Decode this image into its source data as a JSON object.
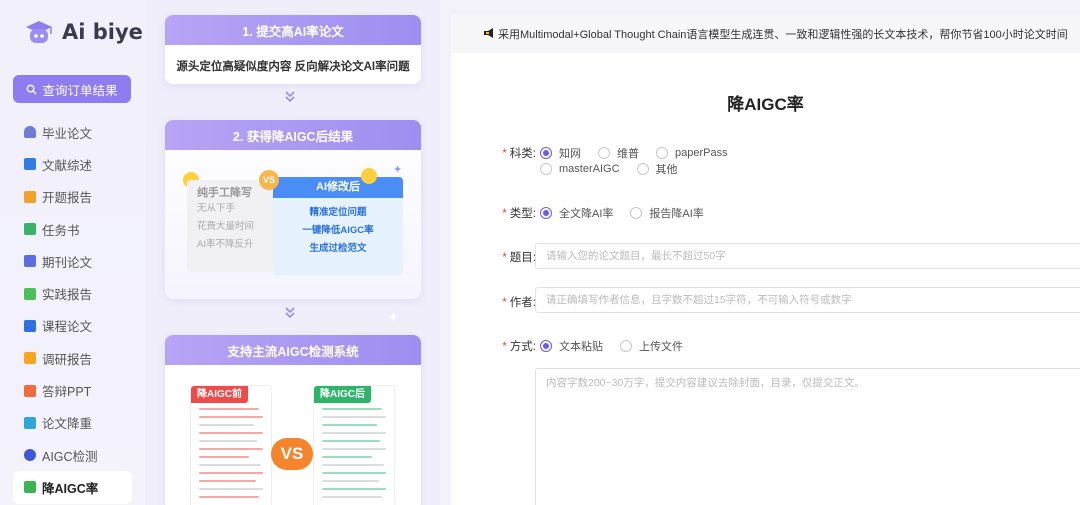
{
  "brand": {
    "name": "Ai biye"
  },
  "sidebar": {
    "order_button": "查询订单结果",
    "items": [
      {
        "label": "毕业论文",
        "icon": "graduation-cap-icon",
        "color": "#6d7bd9"
      },
      {
        "label": "文献综述",
        "icon": "book-icon",
        "color": "#2f7de1"
      },
      {
        "label": "开题报告",
        "icon": "report-icon",
        "color": "#f2a22b"
      },
      {
        "label": "任务书",
        "icon": "task-book-icon",
        "color": "#37b36a"
      },
      {
        "label": "期刊论文",
        "icon": "journal-icon",
        "color": "#5b6ee1"
      },
      {
        "label": "实践报告",
        "icon": "practice-report-icon",
        "color": "#4cbf5a"
      },
      {
        "label": "课程论文",
        "icon": "course-paper-icon",
        "color": "#2f6fe1"
      },
      {
        "label": "调研报告",
        "icon": "survey-icon",
        "color": "#f5a623"
      },
      {
        "label": "答辩PPT",
        "icon": "ppt-icon",
        "color": "#f06a3c"
      },
      {
        "label": "论文降重",
        "icon": "paper-reduce-icon",
        "color": "#2fa5d9"
      },
      {
        "label": "AIGC检测",
        "icon": "aigc-detect-icon",
        "color": "#3c5ad6"
      },
      {
        "label": "降AIGC率",
        "icon": "ai-reduce-icon",
        "color": "#3cb454",
        "active": true
      }
    ]
  },
  "promo": {
    "step1_title": "1. 提交高AI率论文",
    "step1_sub": "源头定位高疑似度内容 反向解决论文AI率问题",
    "step2_title": "2. 获得降AIGC后结果",
    "manual_title": "纯手工降写",
    "manual_lines": [
      "无从下手",
      "花费大量时间",
      "AI率不降反升"
    ],
    "ai_title": "AI修改后",
    "ai_lines": [
      "精准定位问题",
      "一键降低AIGC率",
      "生成过检范文"
    ],
    "vs_small": "VS",
    "step3_title": "支持主流AIGC检测系统",
    "before_tag": "降AIGC前",
    "after_tag": "降AIGC后",
    "vs_big": "VS"
  },
  "main": {
    "banner": "采用Multimodal+Global Thought Chain语言模型生成连贯、一致和逻辑性强的长文本技术，帮你节省100小时论文时间",
    "title": "降AIGC率",
    "subject_label": "科类:",
    "subject_options": [
      "知网",
      "维普",
      "paperPass",
      "masterAIGC",
      "其他"
    ],
    "type_label": "类型:",
    "type_options": [
      "全文降AI率",
      "报告降AI率"
    ],
    "topic_label": "题目:",
    "topic_placeholder": "请输入您的论文题目，最长不超过50字",
    "author_label": "作者:",
    "author_placeholder": "请正确填写作者信息，且字数不超过15字符，不可输入符号或数字",
    "method_label": "方式:",
    "method_options": [
      "文本粘贴",
      "上传文件"
    ],
    "content_placeholder": "内容字数200~30万字，提交内容建议去除封面，目录，仅提交正文。"
  },
  "colors": {
    "accent": "#6c5ce7",
    "order_button": "#8e7cf0",
    "required": "#e04848"
  }
}
